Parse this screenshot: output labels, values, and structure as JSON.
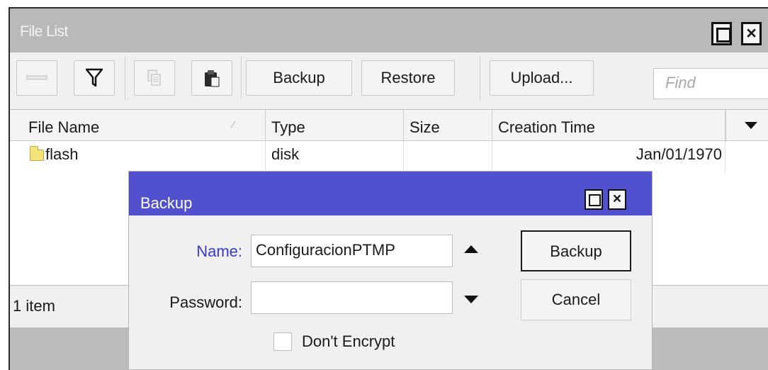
{
  "window": {
    "title": "File List"
  },
  "toolbar": {
    "remove_icon": "minus-icon",
    "filter_icon": "filter-icon",
    "copy_icon": "copy-icon",
    "paste_icon": "paste-icon",
    "backup_label": "Backup",
    "restore_label": "Restore",
    "upload_label": "Upload...",
    "find_placeholder": "Find"
  },
  "table": {
    "columns": [
      "File Name",
      "Type",
      "Size",
      "Creation Time"
    ],
    "rows": [
      {
        "name": "flash",
        "type": "disk",
        "size": "",
        "created": "Jan/01/1970"
      }
    ]
  },
  "status": {
    "count": "1 item"
  },
  "dialog": {
    "title": "Backup",
    "name_label": "Name:",
    "name_value": "ConfiguracionPTMP",
    "password_label": "Password:",
    "password_value": "",
    "dont_encrypt_label": "Don't Encrypt",
    "dont_encrypt_checked": false,
    "backup_button": "Backup",
    "cancel_button": "Cancel",
    "name_label_color": "#3a3ad0",
    "title_color": "#5151cf"
  }
}
